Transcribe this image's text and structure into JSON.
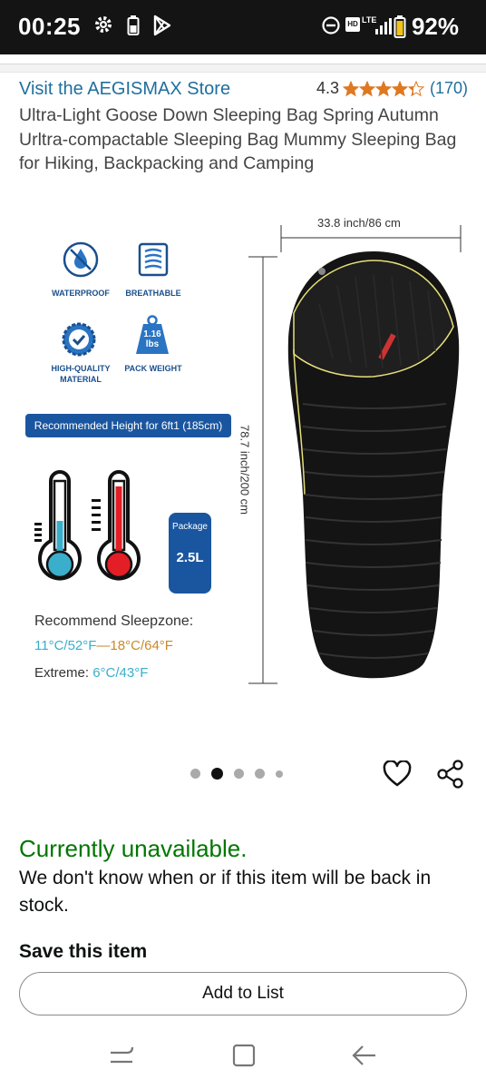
{
  "status_bar": {
    "time": "00:25",
    "network_badge": "HD",
    "network_type": "LTE",
    "battery": "92%"
  },
  "product": {
    "store_link": "Visit the AEGISMAX Store",
    "rating_value": "4.3",
    "rating_stars": 4.3,
    "rating_count": "(170)",
    "title": "Ultra-Light Goose Down Sleeping Bag Spring Autumn Urltra-compactable Sleeping Bag Mummy Sleeping Bag for Hiking, Backpacking and Camping"
  },
  "image": {
    "features": [
      "WATERPROOF",
      "BREATHABLE",
      "HIGH-QUALITY MATERIAL",
      "PACK WEIGHT"
    ],
    "pack_weight": "1.16 lbs",
    "height_recommendation": "Recommended Height for 6ft1 (185cm)",
    "package_label": "Package",
    "package_value": "2.5L",
    "sleepzone_title": "Recommend Sleepzone:",
    "sleepzone_low": "11°C/52°F",
    "sleepzone_dash": "—",
    "sleepzone_high": "18°C/64°F",
    "extreme_label": "Extreme:",
    "extreme_value": "6°C/43°F",
    "width_dimension": "33.8 inch/86 cm",
    "length_dimension": "78.7 inch/200 cm",
    "colors": {
      "brand_blue": "#1a56a0",
      "warm_orange": "#c98a2a",
      "cold_teal": "#3aaecb"
    }
  },
  "carousel": {
    "total": 5,
    "active_index": 1
  },
  "availability": {
    "status": "Currently unavailable.",
    "note": "We don't know when or if this item will be back in stock.",
    "status_color": "#007600"
  },
  "save": {
    "title": "Save this item",
    "add_to_list": "Add to List"
  },
  "icons": [
    "gear-icon",
    "battery-small-icon",
    "play-store-icon",
    "do-not-disturb-icon",
    "signal-icon",
    "battery-icon",
    "heart-icon",
    "share-icon",
    "recent-apps-icon",
    "home-icon",
    "back-icon"
  ]
}
